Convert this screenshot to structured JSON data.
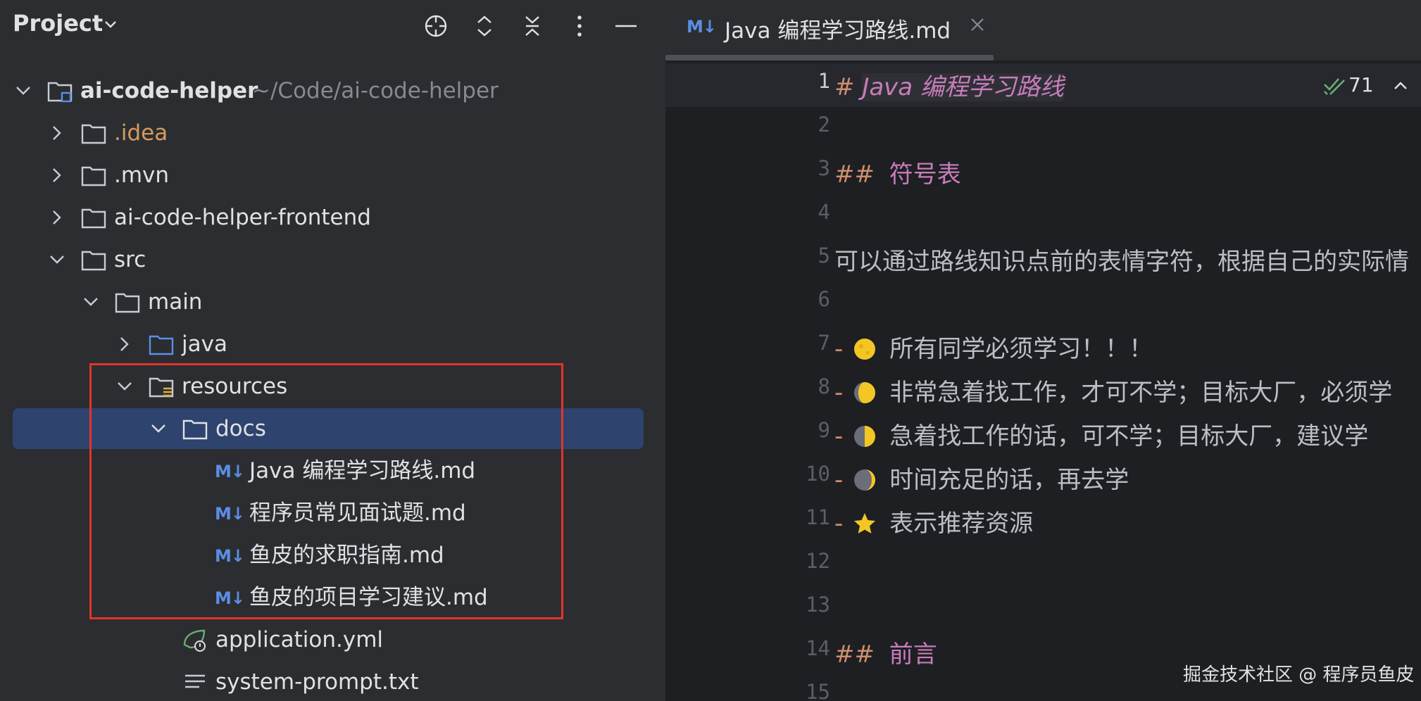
{
  "project": {
    "title": "Project",
    "toolbar": [
      "locate-icon",
      "expand-all-icon",
      "collapse-all-icon",
      "more-options-icon",
      "hide-icon"
    ]
  },
  "tree": {
    "root": {
      "name": "ai-code-helper",
      "path": "~/Code/ai-code-helper"
    },
    "idea": ".idea",
    "mvn": ".mvn",
    "frontend": "ai-code-helper-frontend",
    "src": "src",
    "main": "main",
    "java": "java",
    "resources": "resources",
    "docs": "docs",
    "md_badge": "M↓",
    "files": [
      "Java 编程学习路线.md",
      "程序员常见面试题.md",
      "鱼皮的求职指南.md",
      "鱼皮的项目学习建议.md"
    ],
    "application": "application.yml",
    "system_prompt": "system-prompt.txt"
  },
  "editor": {
    "tab_badge": "M↓",
    "tab_title": "Java 编程学习路线.md",
    "inspections_count": "71",
    "line_numbers": [
      "1",
      "2",
      "3",
      "4",
      "5",
      "6",
      "7",
      "8",
      "9",
      "10",
      "11",
      "12",
      "13",
      "14",
      "15"
    ],
    "h1_mark": "#",
    "h1_text": "Java 编程学习路线",
    "h2_mark": "##",
    "h2_symbols": "符号表",
    "intro": "可以通过路线知识点前的表情字符，根据自己的实际情",
    "bullet_dash": "-",
    "bullets": [
      "所有同学必须学习！！！",
      "非常急着找工作，才可不学；目标大厂，必须学",
      "急着找工作的话，可不学；目标大厂，建议学",
      "时间充足的话，再去学",
      "表示推荐资源"
    ],
    "h2_preface": "前言"
  },
  "watermark": "掘金技术社区 @ 程序员鱼皮"
}
